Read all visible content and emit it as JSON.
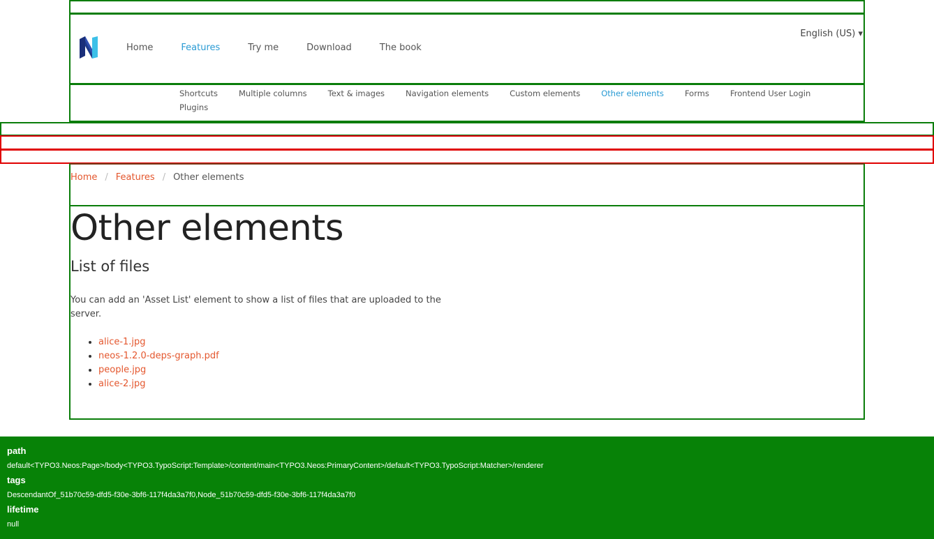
{
  "header": {
    "nav": [
      {
        "label": "Home"
      },
      {
        "label": "Features"
      },
      {
        "label": "Try me"
      },
      {
        "label": "Download"
      },
      {
        "label": "The book"
      }
    ],
    "language": "English (US) ▾"
  },
  "subnav": [
    {
      "label": "Shortcuts"
    },
    {
      "label": "Multiple columns"
    },
    {
      "label": "Text & images"
    },
    {
      "label": "Navigation elements"
    },
    {
      "label": "Custom elements"
    },
    {
      "label": "Other elements"
    },
    {
      "label": "Forms"
    },
    {
      "label": "Frontend User Login"
    },
    {
      "label": "Plugins"
    }
  ],
  "breadcrumb": {
    "home": "Home",
    "features": "Features",
    "current": "Other elements",
    "separator": "/"
  },
  "content": {
    "title": "Other elements",
    "subtitle": "List of files",
    "intro": "You can add an 'Asset List' element to show a list of files that are uploaded to the server.",
    "files": [
      {
        "name": "alice-1.jpg"
      },
      {
        "name": "neos-1.2.0-deps-graph.pdf"
      },
      {
        "name": "people.jpg"
      },
      {
        "name": "alice-2.jpg"
      }
    ]
  },
  "debug": {
    "path_label": "path",
    "path_value": "default<TYPO3.Neos:Page>/body<TYPO3.TypoScript:Template>/content/main<TYPO3.Neos:PrimaryContent>/default<TYPO3.TypoScript:Matcher>/renderer",
    "tags_label": "tags",
    "tags_value": "DescendantOf_51b70c59-dfd5-f30e-3bf6-117f4da3a7f0,Node_51b70c59-dfd5-f30e-3bf6-117f4da3a7f0",
    "lifetime_label": "lifetime",
    "lifetime_value": "null"
  },
  "colors": {
    "accent_link": "#e4572e",
    "active_nav": "#2a9bd4",
    "debug_bg": "#078207",
    "outline_green": "#0a7d0a",
    "outline_red": "#e00000"
  }
}
